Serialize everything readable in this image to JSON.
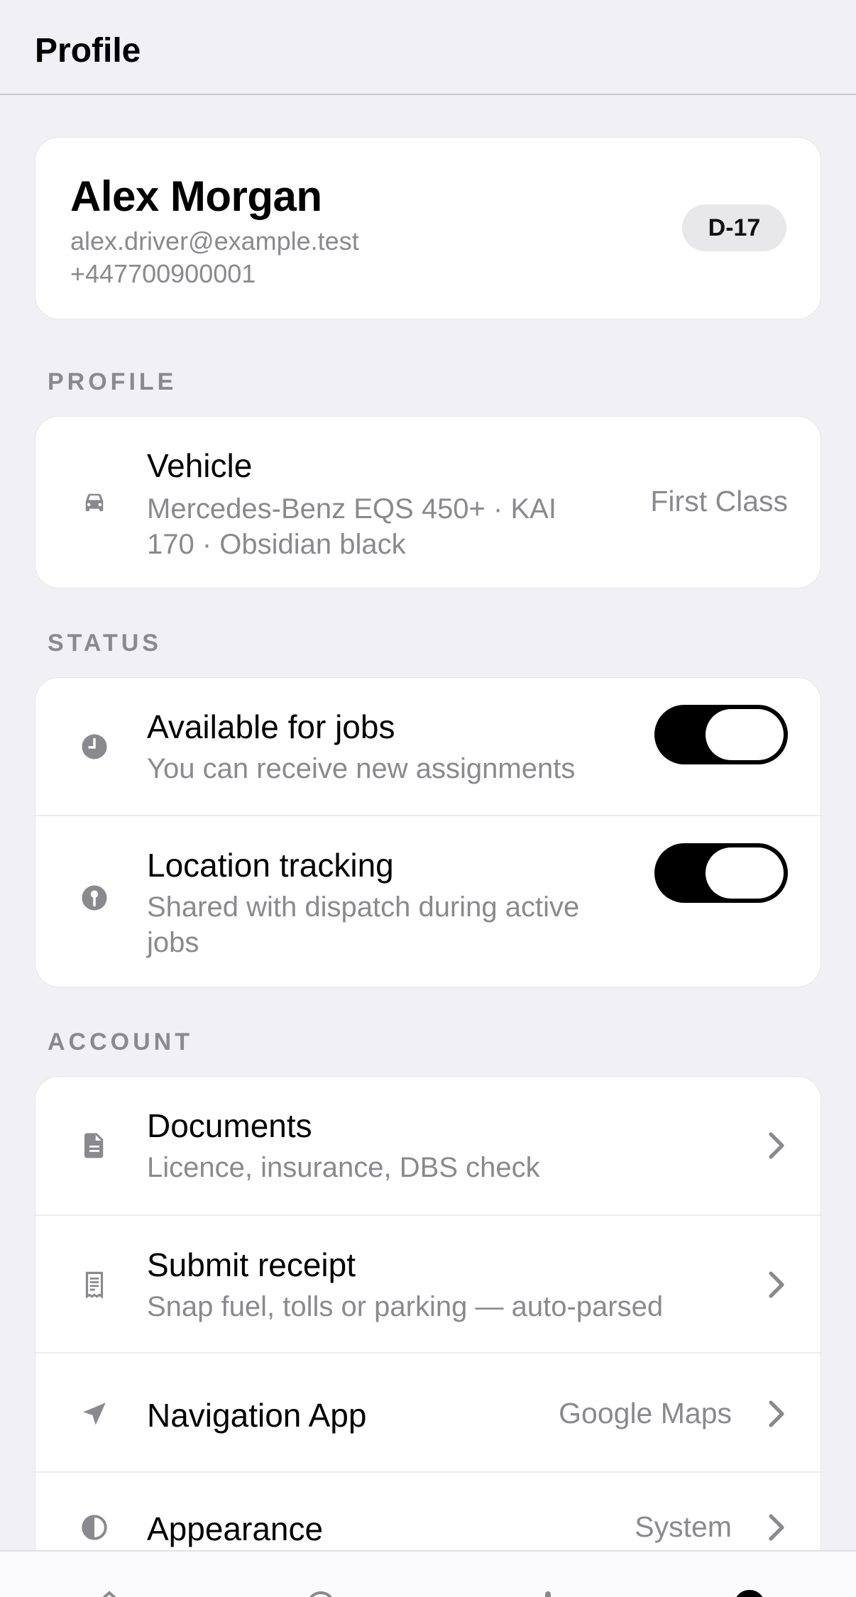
{
  "header": {
    "title": "Profile"
  },
  "profile": {
    "name": "Alex Morgan",
    "email": "alex.driver@example.test",
    "phone": "+447700900001",
    "badge": "D-17"
  },
  "sections": {
    "profile_label": "PROFILE",
    "status_label": "STATUS",
    "account_label": "ACCOUNT"
  },
  "vehicle": {
    "title": "Vehicle",
    "subtitle_line1": "Mercedes-Benz EQS 450+ · KAI",
    "subtitle_line2": "170 · Obsidian black",
    "class": "First Class",
    "icon": "car-icon"
  },
  "status": {
    "available": {
      "title": "Available for jobs",
      "subtitle": "You can receive new assignments",
      "on": true,
      "icon": "clock-icon"
    },
    "location": {
      "title": "Location tracking",
      "subtitle_line1": "Shared with dispatch during active",
      "subtitle_line2": "jobs",
      "on": true,
      "icon": "location-pin-icon"
    }
  },
  "account": {
    "documents": {
      "title": "Documents",
      "subtitle": "Licence, insurance, DBS check",
      "icon": "document-icon"
    },
    "receipt": {
      "title": "Submit receipt",
      "subtitle": "Snap fuel, tolls or parking — auto-parsed",
      "icon": "receipt-icon"
    },
    "navigation": {
      "title": "Navigation App",
      "value": "Google Maps",
      "icon": "navigation-arrow-icon"
    },
    "appearance": {
      "title": "Appearance",
      "value": "System",
      "icon": "appearance-icon"
    }
  },
  "colors": {
    "background": "#f0f0f5",
    "secondary_text": "#8a8a8e",
    "toggle_on": "#000000"
  },
  "tabbar": {
    "icons": [
      "home-icon",
      "history-icon",
      "earnings-icon",
      "profile-icon"
    ],
    "active": "profile-icon"
  }
}
